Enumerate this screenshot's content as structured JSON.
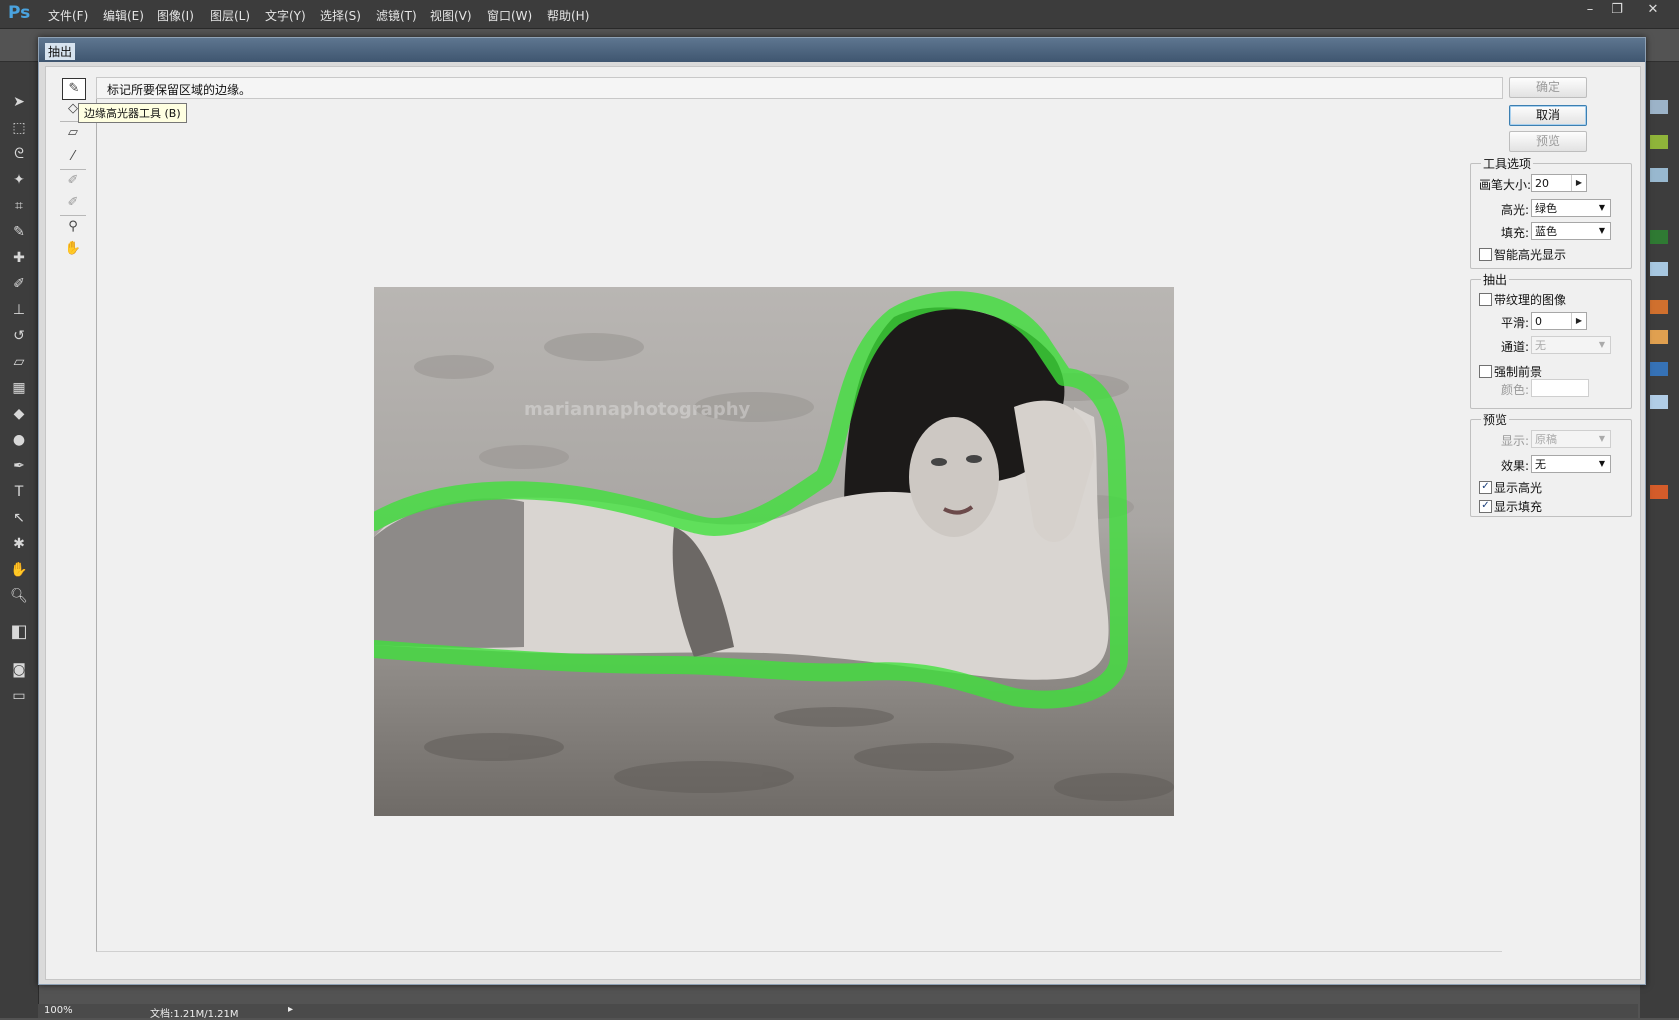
{
  "app": {
    "logo": "Ps",
    "menus": [
      "文件(F)",
      "编辑(E)",
      "图像(I)",
      "图层(L)",
      "文字(Y)",
      "选择(S)",
      "滤镜(T)",
      "视图(V)",
      "窗口(W)",
      "帮助(H)"
    ]
  },
  "statusbar": {
    "zoom": "100%",
    "doc_info": "文档:1.21M/1.21M"
  },
  "dialog": {
    "title": "抽出",
    "hint": "标记所要保留区域的边缘。",
    "tooltip": "边缘高光器工具 (B)",
    "buttons": {
      "ok": "确定",
      "cancel": "取消",
      "preview": "预览"
    },
    "tool_options": {
      "title": "工具选项",
      "brush_size_label": "画笔大小:",
      "brush_size": "20",
      "highlight_label": "高光:",
      "highlight": "绿色",
      "fill_label": "填充:",
      "fill": "蓝色",
      "smart_highlight_label": "智能高光显示",
      "smart_highlight": false
    },
    "extraction": {
      "title": "抽出",
      "textured_label": "带纹理的图像",
      "textured": false,
      "smooth_label": "平滑:",
      "smooth": "0",
      "channel_label": "通道:",
      "channel": "无",
      "force_fg_label": "强制前景",
      "force_fg": false,
      "color_label": "颜色:"
    },
    "preview": {
      "title": "预览",
      "show_label": "显示:",
      "show": "原稿",
      "effect_label": "效果:",
      "effect": "无",
      "show_highlight_label": "显示高光",
      "show_highlight": true,
      "show_fill_label": "显示填充",
      "show_fill": true
    },
    "photo_watermark": "mariannaphotography"
  },
  "colors": {
    "highlight": "#3de13a",
    "accent": "#4aa3df"
  }
}
